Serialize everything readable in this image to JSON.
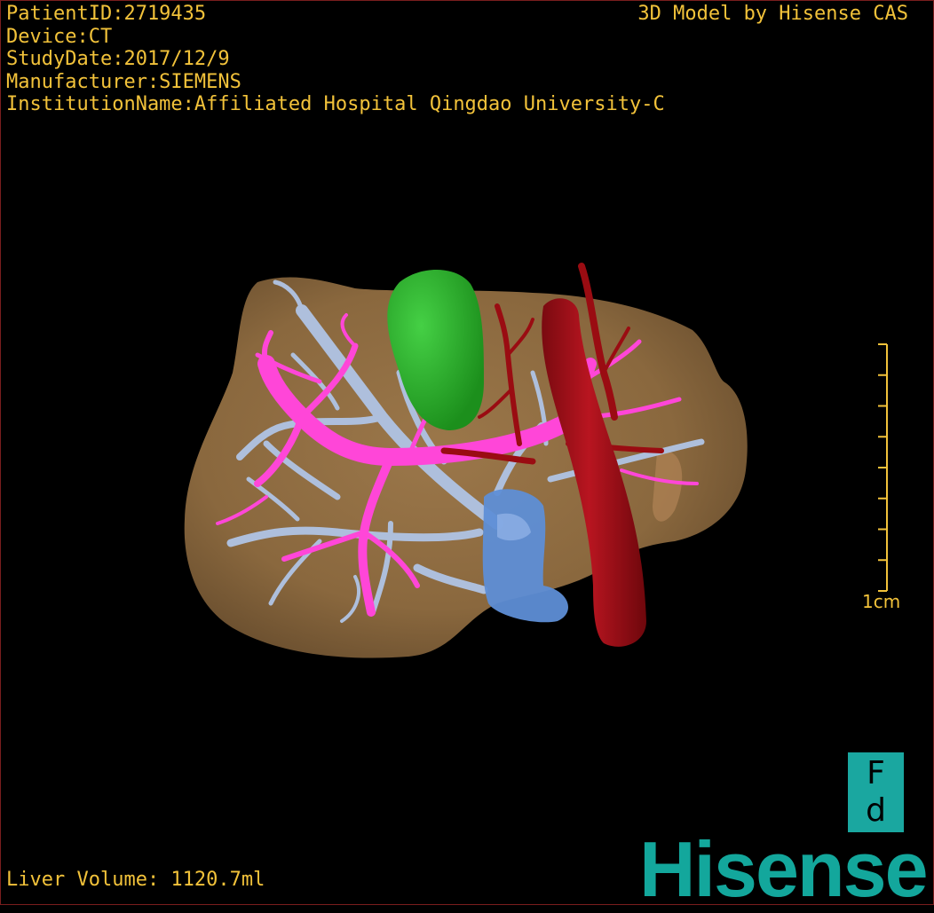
{
  "header": {
    "patient_id": "PatientID:2719435",
    "device": "Device:CT",
    "study_date": "StudyDate:2017/12/9",
    "manufacturer": "Manufacturer:SIEMENS",
    "institution": "InstitutionName:Affiliated Hospital Qingdao University-C"
  },
  "brand_top": "3D Model by Hisense CAS",
  "scale_bar": {
    "label": "1cm",
    "ticks": 9
  },
  "orientation": {
    "top": "F",
    "bottom": "d"
  },
  "volume": "Liver Volume: 1120.7ml",
  "logo": "Hisense",
  "colors": {
    "overlay_text": "#f2c23a",
    "liver": "#8c6a3f",
    "portal_vein": "#ff46d8",
    "hepatic_vein": "#aebfdc",
    "ivc": "#5e8ed6",
    "aorta": "#a30d14",
    "gallbladder": "#2fb52f",
    "brand": "#13a79c"
  },
  "structures": [
    "liver",
    "hepatic-vein",
    "portal-vein",
    "gallbladder",
    "inferior-vena-cava",
    "hepatic-artery",
    "aorta"
  ]
}
